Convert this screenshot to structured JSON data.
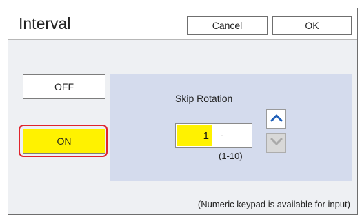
{
  "header": {
    "title": "Interval",
    "cancel_label": "Cancel",
    "ok_label": "OK"
  },
  "mode": {
    "off_label": "OFF",
    "on_label": "ON",
    "selected": "ON"
  },
  "skip_rotation": {
    "label": "Skip Rotation",
    "value": "1",
    "suffix": "-",
    "range": "(1-10)"
  },
  "footer": {
    "note": "(Numeric keypad is available for input)"
  },
  "icons": {
    "up": "chevron-up-icon",
    "down": "chevron-down-icon"
  },
  "colors": {
    "selected_yellow": "#fff200",
    "highlight_red": "#e0242c",
    "panel_blue": "#d4dbed",
    "arrow_blue": "#1f5fb8"
  }
}
